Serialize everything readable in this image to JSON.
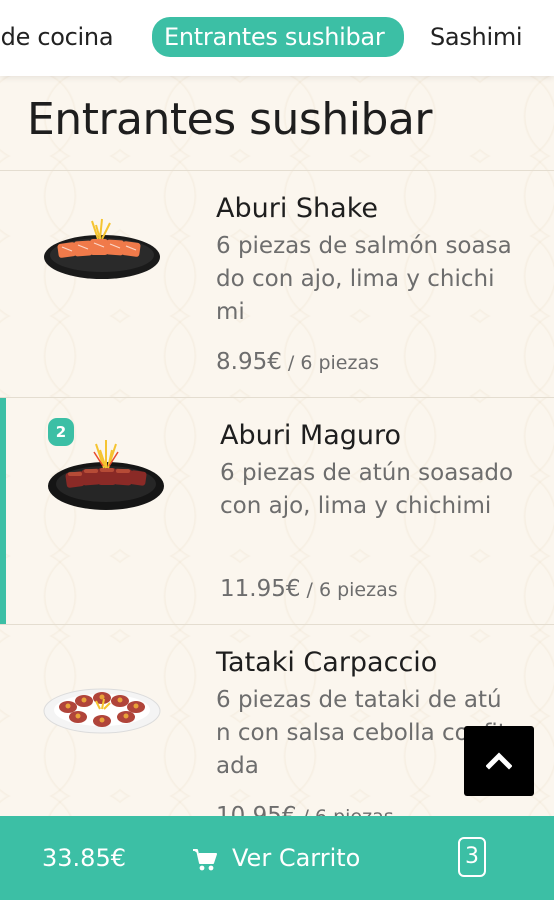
{
  "nav": {
    "tabs": [
      {
        "label": ". de cocina",
        "active": false
      },
      {
        "label": "Entrantes sushibar",
        "active": true
      },
      {
        "label": "Sashimi",
        "active": false
      }
    ]
  },
  "section": {
    "title": "Entrantes sushibar"
  },
  "items": [
    {
      "name": "Aburi Shake",
      "description": "6 piezas de salmón soasado con ajo, lima y chichimi",
      "price": "8.95€",
      "unit": " / 6 piezas",
      "quantity": null,
      "image_icon": "salmon-plate-icon"
    },
    {
      "name": "Aburi Maguro",
      "description": "6 piezas de atún soasado con ajo, lima y chichimi",
      "price": "11.95€",
      "unit": " / 6 piezas",
      "quantity": "2",
      "image_icon": "tuna-plate-icon"
    },
    {
      "name": "Tataki Carpaccio",
      "description": "6 piezas de tataki de atún con salsa cebolla confitada",
      "price": "10.95€",
      "unit": " / 6 piezas",
      "quantity": null,
      "image_icon": "carpaccio-plate-icon"
    }
  ],
  "cart": {
    "total": "33.85€",
    "label": "Ver Carrito",
    "count": "3",
    "icon": "cart-icon"
  },
  "scroll_top": {
    "icon": "chevron-up-icon"
  },
  "colors": {
    "accent": "#3cbfa5",
    "background": "#fbf6ee",
    "text": "#1e1e1e",
    "muted": "#6d6d6d"
  }
}
